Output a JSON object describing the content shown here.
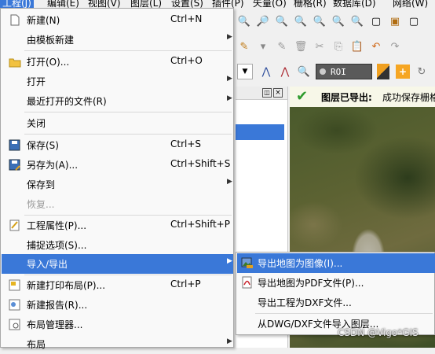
{
  "menubar": {
    "items": [
      "工程(J)",
      "编辑(E)",
      "视图(V)",
      "图层(L)",
      "设置(S)",
      "插件(P)",
      "矢量(O)",
      "栅格(R)",
      "数据库(D)",
      "网络(W)"
    ]
  },
  "toolbar": {
    "roi_label": "ROI"
  },
  "message_bar": {
    "title": "图层已导出:",
    "text": "成功保存栅格"
  },
  "main_menu": {
    "items": [
      {
        "label": "新建(N)",
        "shortcut": "Ctrl+N",
        "icon": "new-file-icon"
      },
      {
        "label": "由模板新建",
        "shortcut": "",
        "submenu": true
      },
      {
        "label": "打开(O)...",
        "shortcut": "Ctrl+O",
        "icon": "open-folder-icon"
      },
      {
        "label": "打开",
        "shortcut": "",
        "submenu": true
      },
      {
        "label": "最近打开的文件(R)",
        "shortcut": "",
        "submenu": true
      },
      {
        "label": "关闭",
        "shortcut": ""
      },
      {
        "label": "保存(S)",
        "shortcut": "Ctrl+S",
        "icon": "save-icon"
      },
      {
        "label": "另存为(A)...",
        "shortcut": "Ctrl+Shift+S",
        "icon": "save-as-icon"
      },
      {
        "label": "保存到",
        "shortcut": "",
        "submenu": true
      },
      {
        "label": "恢复...",
        "shortcut": "",
        "disabled": true
      },
      {
        "label": "工程属性(P)...",
        "shortcut": "Ctrl+Shift+P",
        "icon": "project-properties-icon"
      },
      {
        "label": "捕捉选项(S)...",
        "shortcut": ""
      },
      {
        "label": "导入/导出",
        "shortcut": "",
        "submenu": true,
        "highlighted": true
      },
      {
        "label": "新建打印布局(P)...",
        "shortcut": "Ctrl+P",
        "icon": "new-print-layout-icon"
      },
      {
        "label": "新建报告(R)...",
        "shortcut": "",
        "icon": "new-report-icon"
      },
      {
        "label": "布局管理器...",
        "shortcut": "",
        "icon": "layout-manager-icon"
      },
      {
        "label": "布局",
        "shortcut": "",
        "submenu": true
      }
    ]
  },
  "submenu": {
    "items": [
      {
        "label": "导出地图为图像(I)...",
        "icon": "export-image-icon",
        "highlighted": true
      },
      {
        "label": "导出地图为PDF文件(P)...",
        "icon": "export-pdf-icon"
      },
      {
        "label": "导出工程为DXF文件...",
        "icon": ""
      },
      {
        "label": "从DWG/DXF文件导入图层...",
        "icon": ""
      }
    ]
  },
  "watermark": "CSDN @Vigo*GIS",
  "colors": {
    "highlight": "#3a78d8",
    "menu_bg": "#f9f9f9",
    "success_check": "#2e9b2e"
  }
}
